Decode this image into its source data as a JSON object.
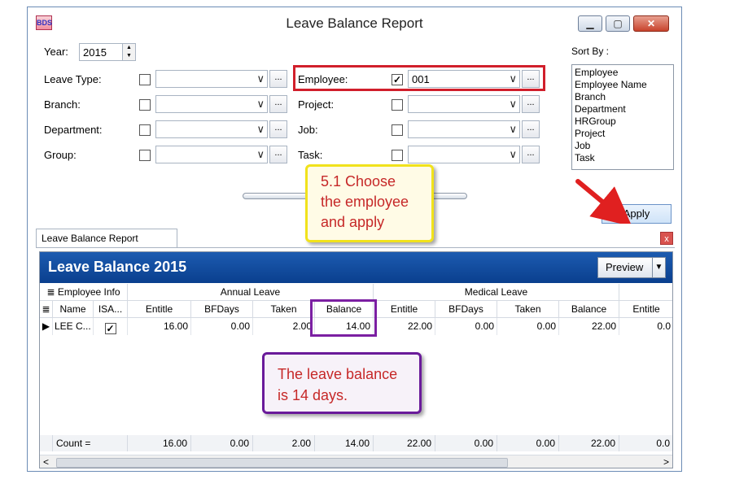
{
  "window": {
    "title": "Leave Balance Report",
    "app_icon_text": "BDS"
  },
  "filters": {
    "year_label": "Year:",
    "year_value": "2015",
    "leave_type_label": "Leave Type:",
    "branch_label": "Branch:",
    "department_label": "Department:",
    "group_label": "Group:",
    "employee_label": "Employee:",
    "employee_checked": true,
    "employee_value": "001",
    "project_label": "Project:",
    "job_label": "Job:",
    "task_label": "Task:",
    "ellipsis": "..."
  },
  "sort": {
    "label": "Sort By :",
    "items": [
      "Employee",
      "Employee Name",
      "Branch",
      "Department",
      "HRGroup",
      "Project",
      "Job",
      "Task"
    ]
  },
  "apply_label": "Apply",
  "tab": {
    "label": "Leave Balance Report",
    "close": "x"
  },
  "report": {
    "title": "Leave Balance 2015",
    "preview_label": "Preview",
    "bands": {
      "employee_info": "Employee Info",
      "annual_leave": "Annual Leave",
      "medical_leave": "Medical Leave"
    },
    "columns": [
      "Name",
      "ISA...",
      "Entitle",
      "BFDays",
      "Taken",
      "Balance",
      "Entitle",
      "BFDays",
      "Taken",
      "Balance",
      "Entitle"
    ],
    "row": {
      "name": "LEE C...",
      "isactive": true,
      "values": [
        "16.00",
        "0.00",
        "2.00",
        "14.00",
        "22.00",
        "0.00",
        "0.00",
        "22.00",
        "0.0"
      ]
    },
    "footer": {
      "count_label": "Count =",
      "values": [
        "16.00",
        "0.00",
        "2.00",
        "14.00",
        "22.00",
        "0.00",
        "0.00",
        "22.00",
        "0.0"
      ]
    }
  },
  "annotations": {
    "note1_lines": [
      "5.1 Choose",
      "the employee",
      "and apply"
    ],
    "note2_lines": [
      "The leave balance",
      "is 14 days."
    ]
  },
  "colors": {
    "red": "#d11f2b",
    "purple": "#7b1fa2",
    "yellow": "#f1e21b",
    "header_blue": "#0a3f8e"
  }
}
